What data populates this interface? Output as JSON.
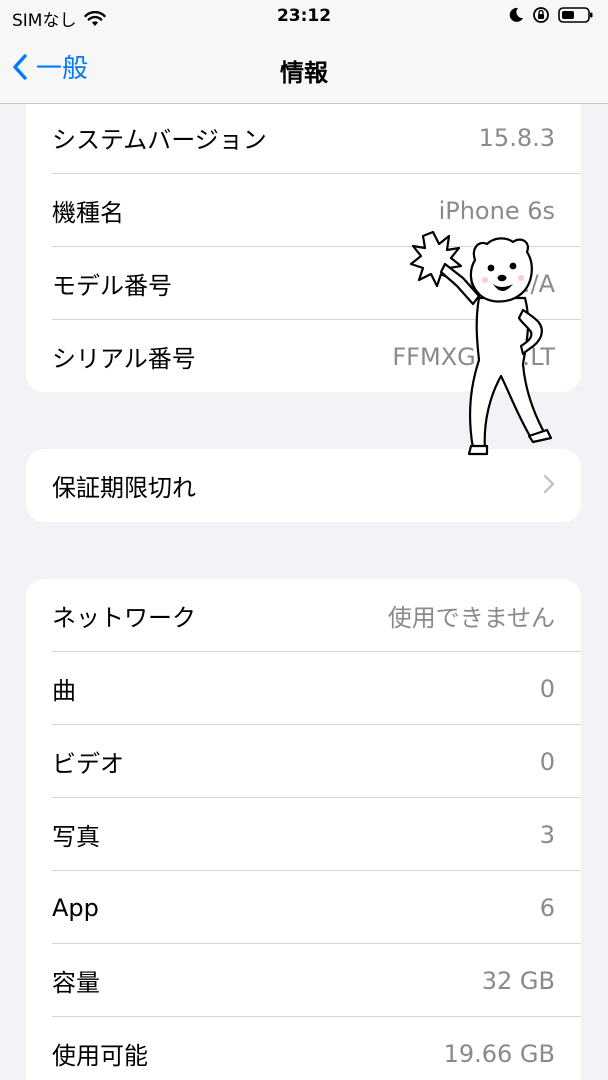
{
  "status": {
    "carrier": "SIMなし",
    "time": "23:12"
  },
  "nav": {
    "back_label": "一般",
    "title": "情報"
  },
  "groups": [
    {
      "rows": [
        {
          "label": "システムバージョン",
          "value": "15.8.3"
        },
        {
          "label": "機種名",
          "value": "iPhone 6s"
        },
        {
          "label": "モデル番号",
          "value": "MN…/A"
        },
        {
          "label": "シリアル番号",
          "value": "FFMXG71…LT"
        }
      ]
    },
    {
      "rows": [
        {
          "label": "保証期限切れ"
        }
      ]
    },
    {
      "rows": [
        {
          "label": "ネットワーク",
          "value": "使用できません"
        },
        {
          "label": "曲",
          "value": "0"
        },
        {
          "label": "ビデオ",
          "value": "0"
        },
        {
          "label": "写真",
          "value": "3"
        },
        {
          "label": "App",
          "value": "6"
        },
        {
          "label": "容量",
          "value": "32 GB"
        },
        {
          "label": "使用可能",
          "value": "19.66 GB"
        }
      ]
    }
  ],
  "colors": {
    "accent": "#007aff",
    "background": "#f2f2f7",
    "secondary_text": "#8a8a8e"
  },
  "icons": [
    "wifi-icon",
    "moon-icon",
    "rotation-lock-icon",
    "battery-icon",
    "back-chevron-icon",
    "chevron-right-icon"
  ]
}
